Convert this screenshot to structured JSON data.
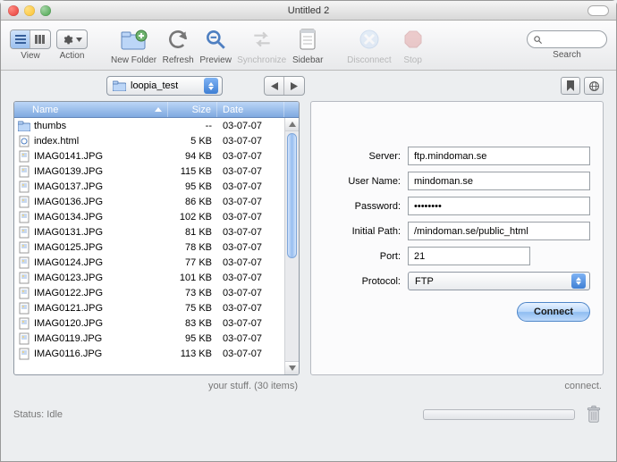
{
  "window": {
    "title": "Untitled 2"
  },
  "toolbar": {
    "view": "View",
    "action": "Action",
    "new_folder": "New Folder",
    "refresh": "Refresh",
    "preview": "Preview",
    "synchronize": "Synchronize",
    "sidebar": "Sidebar",
    "disconnect": "Disconnect",
    "stop": "Stop",
    "search": "Search"
  },
  "search": {
    "value": "",
    "placeholder": ""
  },
  "path": {
    "folder": "loopia_test"
  },
  "columns": {
    "name": "Name",
    "size": "Size",
    "date": "Date"
  },
  "files": [
    {
      "name": "thumbs",
      "size": "--",
      "date": "03-07-07",
      "kind": "folder"
    },
    {
      "name": "index.html",
      "size": "5 KB",
      "date": "03-07-07",
      "kind": "html"
    },
    {
      "name": "IMAG0141.JPG",
      "size": "94 KB",
      "date": "03-07-07",
      "kind": "image"
    },
    {
      "name": "IMAG0139.JPG",
      "size": "115 KB",
      "date": "03-07-07",
      "kind": "image"
    },
    {
      "name": "IMAG0137.JPG",
      "size": "95 KB",
      "date": "03-07-07",
      "kind": "image"
    },
    {
      "name": "IMAG0136.JPG",
      "size": "86 KB",
      "date": "03-07-07",
      "kind": "image"
    },
    {
      "name": "IMAG0134.JPG",
      "size": "102 KB",
      "date": "03-07-07",
      "kind": "image"
    },
    {
      "name": "IMAG0131.JPG",
      "size": "81 KB",
      "date": "03-07-07",
      "kind": "image"
    },
    {
      "name": "IMAG0125.JPG",
      "size": "78 KB",
      "date": "03-07-07",
      "kind": "image"
    },
    {
      "name": "IMAG0124.JPG",
      "size": "77 KB",
      "date": "03-07-07",
      "kind": "image"
    },
    {
      "name": "IMAG0123.JPG",
      "size": "101 KB",
      "date": "03-07-07",
      "kind": "image"
    },
    {
      "name": "IMAG0122.JPG",
      "size": "73 KB",
      "date": "03-07-07",
      "kind": "image"
    },
    {
      "name": "IMAG0121.JPG",
      "size": "75 KB",
      "date": "03-07-07",
      "kind": "image"
    },
    {
      "name": "IMAG0120.JPG",
      "size": "83 KB",
      "date": "03-07-07",
      "kind": "image"
    },
    {
      "name": "IMAG0119.JPG",
      "size": "95 KB",
      "date": "03-07-07",
      "kind": "image"
    },
    {
      "name": "IMAG0116.JPG",
      "size": "113 KB",
      "date": "03-07-07",
      "kind": "image"
    }
  ],
  "footer": {
    "left": "your stuff. (30 items)",
    "right": "connect."
  },
  "form": {
    "labels": {
      "server": "Server:",
      "username": "User Name:",
      "password": "Password:",
      "path": "Initial Path:",
      "port": "Port:",
      "protocol": "Protocol:"
    },
    "server": "ftp.mindoman.se",
    "username": "mindoman.se",
    "password": "••••••••",
    "path": "/mindoman.se/public_html",
    "port": "21",
    "protocol": "FTP",
    "connect": "Connect"
  },
  "status": "Status: Idle"
}
